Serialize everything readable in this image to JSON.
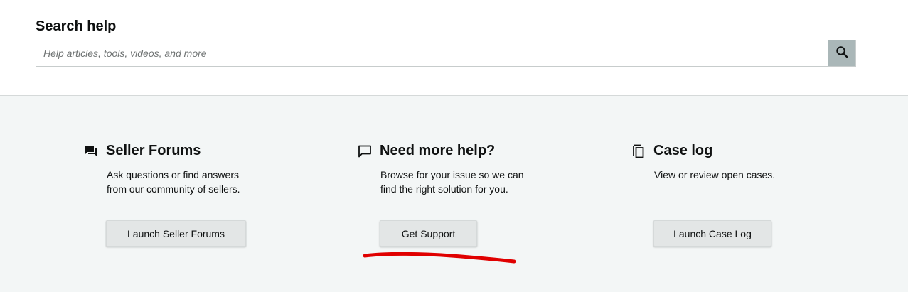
{
  "search": {
    "title": "Search help",
    "placeholder": "Help articles, tools, videos, and more",
    "value": "",
    "button_icon": "search-icon"
  },
  "cards": [
    {
      "icon": "forum-icon",
      "title": "Seller Forums",
      "description": "Ask questions or find answers from our community of sellers.",
      "button_label": "Launch Seller Forums"
    },
    {
      "icon": "chat-bubble-icon",
      "title": "Need more help?",
      "description": "Browse for your issue so we can find the right solution for you.",
      "button_label": "Get Support"
    },
    {
      "icon": "copy-icon",
      "title": "Case log",
      "description": "View or review open cases.",
      "button_label": "Launch Case Log"
    }
  ],
  "colors": {
    "background_top": "#ffffff",
    "background_bottom": "#f3f6f6",
    "search_button": "#aab7b8",
    "button_bg": "#e3e6e6",
    "annotation_red": "#e00000"
  }
}
